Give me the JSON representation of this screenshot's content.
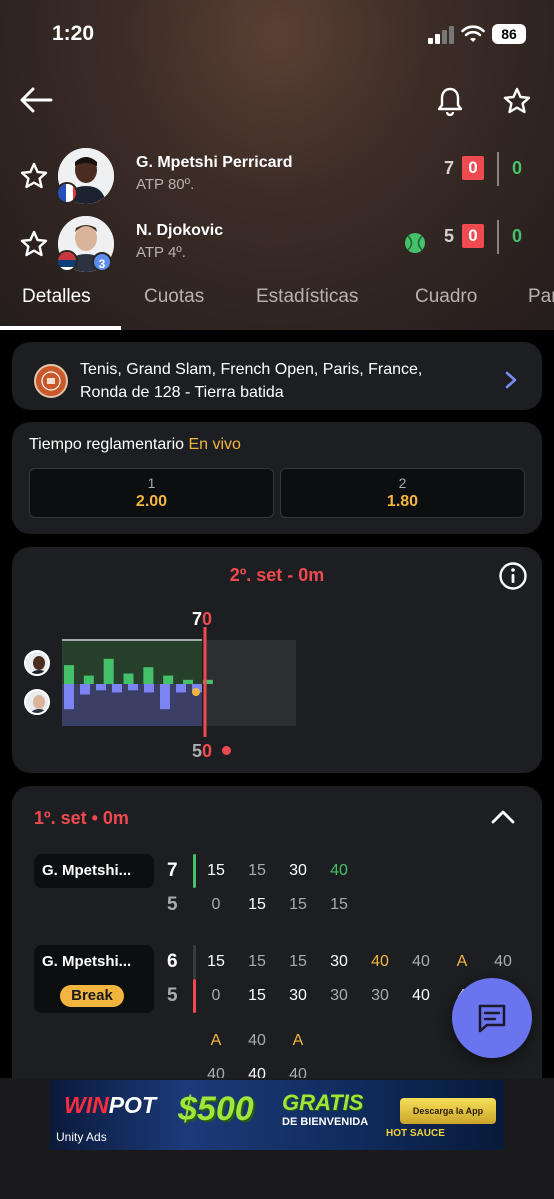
{
  "status_bar": {
    "time": "1:20",
    "battery": "86"
  },
  "header": {
    "icons": {
      "back": "arrow-left-icon",
      "notify": "bell-icon",
      "favorite": "star-icon"
    },
    "players": [
      {
        "name": "G. Mpetshi Perricard",
        "rank": "ATP 80º.",
        "games": "7",
        "point": "0",
        "sets": "0",
        "flag": "France"
      },
      {
        "name": "N. Djokovic",
        "rank": "ATP 4º.",
        "games": "5",
        "point": "0",
        "sets": "0",
        "flag": "Serbia",
        "seed": "3",
        "serving": true
      }
    ]
  },
  "tabs": [
    "Detalles",
    "Cuotas",
    "Estadísticas",
    "Cuadro",
    "Par"
  ],
  "tournament": {
    "line1": "Tenis, Grand Slam, French Open, Paris, France,",
    "line2": "Ronda de 128 - Tierra batida"
  },
  "odds": {
    "title": "Tiempo reglamentario",
    "live": "En vivo",
    "options": [
      {
        "label": "1",
        "value": "2.00"
      },
      {
        "label": "2",
        "value": "1.80"
      }
    ]
  },
  "momentum": {
    "title": "2º. set - 0m",
    "top_score": {
      "games": "7",
      "point": "0"
    },
    "bottom_score": {
      "games": "5",
      "point": "0"
    },
    "bars": [
      {
        "player": 1,
        "value": 0.45
      },
      {
        "player": 1,
        "value": 0.2
      },
      {
        "player": 1,
        "value": 0.6
      },
      {
        "player": 1,
        "value": 0.25
      },
      {
        "player": 1,
        "value": 0.4
      },
      {
        "player": 1,
        "value": 0.2
      },
      {
        "player": 1,
        "value": 0.1
      },
      {
        "player": 1,
        "value": 0.1
      },
      {
        "player": 2,
        "value": 0.6
      },
      {
        "player": 2,
        "value": 0.25
      },
      {
        "player": 2,
        "value": 0.15
      },
      {
        "player": 2,
        "value": 0.2
      },
      {
        "player": 2,
        "value": 0.15
      },
      {
        "player": 2,
        "value": 0.2
      },
      {
        "player": 2,
        "value": 0.6
      },
      {
        "player": 2,
        "value": 0.2
      },
      {
        "player": 2,
        "value": 0.2
      }
    ]
  },
  "pbp": {
    "title": "1º. set • 0m",
    "games": [
      {
        "server": "G. Mpetshi...",
        "top": {
          "games": "7",
          "points": [
            "15",
            "15",
            "30",
            "40"
          ]
        },
        "bottom": {
          "games": "5",
          "points": [
            "0",
            "15",
            "15",
            "15"
          ]
        }
      },
      {
        "server": "G. Mpetshi...",
        "badge": "Break",
        "top": {
          "games": "6",
          "points": [
            "15",
            "15",
            "15",
            "30",
            "40",
            "40",
            "A",
            "40"
          ]
        },
        "bottom": {
          "games": "5",
          "points": [
            "0",
            "15",
            "30",
            "30",
            "30",
            "40",
            "4"
          ]
        }
      }
    ],
    "extra_top": [
      "A",
      "40",
      "A"
    ],
    "extra_bottom": [
      "40",
      "40",
      "40"
    ]
  },
  "fab": {
    "icon": "chat-icon"
  },
  "ad": {
    "brand_a": "WIN",
    "brand_b": "POT",
    "amount": "$500",
    "gratis": "GRATIS",
    "bienvenida": "DE BIENVENIDA",
    "cta": "Descarga la App",
    "unity": "Unity Ads",
    "hot": "HOT SAUCE"
  }
}
